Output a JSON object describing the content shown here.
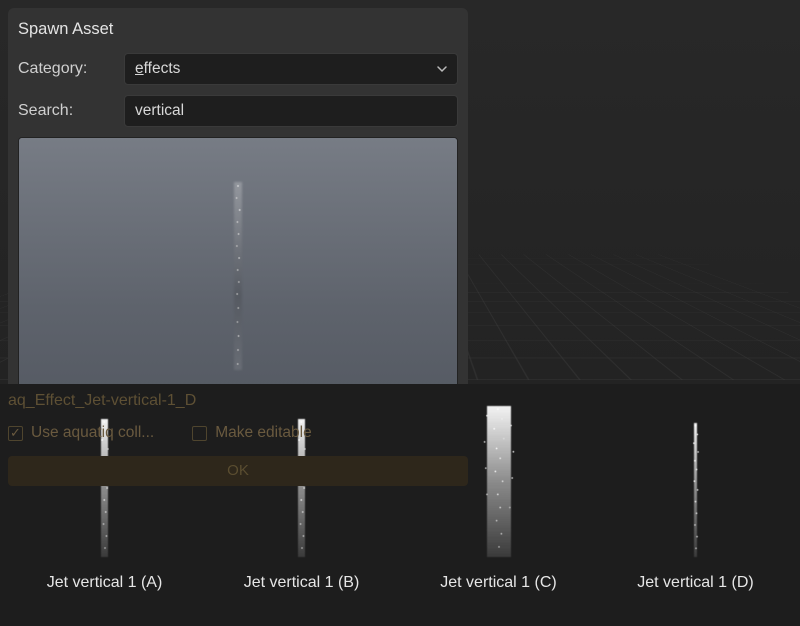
{
  "panel": {
    "title": "Spawn Asset",
    "category_label": "Category:",
    "category_value": "effects",
    "search_label": "Search:",
    "search_value": "vertical"
  },
  "overlay": {
    "filename": "aq_Effect_Jet-vertical-1_D",
    "use_collection_label": "Use aquatiq coll...",
    "make_editable_label": "Make editable",
    "use_collection_checked": true,
    "make_editable_checked": false,
    "ok_label": "OK"
  },
  "assets": [
    {
      "label": "Jet vertical 1 (A)",
      "variant": "a"
    },
    {
      "label": "Jet vertical 1 (B)",
      "variant": "b"
    },
    {
      "label": "Jet vertical 1 (C)",
      "variant": "c"
    },
    {
      "label": "Jet vertical 1 (D)",
      "variant": "d"
    }
  ]
}
